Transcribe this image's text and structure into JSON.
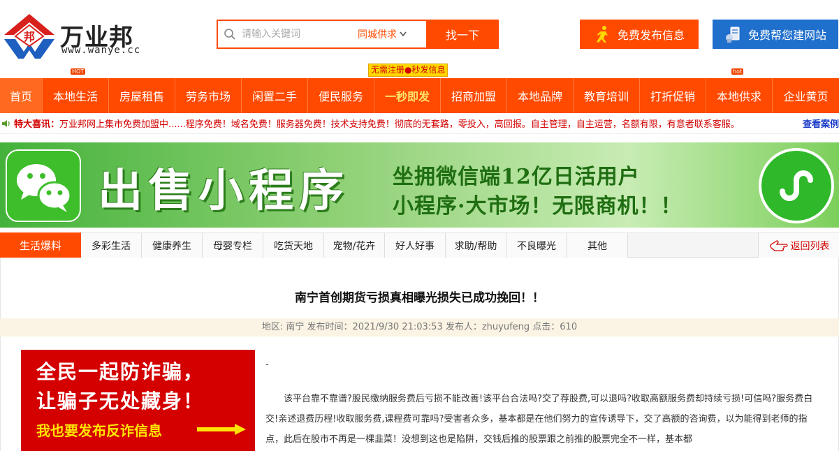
{
  "header": {
    "logo_text": "万业邦",
    "logo_url": "www.wanye.cc",
    "logo_glyph": "邦",
    "search_placeholder": "请输入关键词",
    "search_select": "同城供求",
    "search_button": "找一下",
    "publish_button": "免费发布信息",
    "site_button": "免费帮您建网站"
  },
  "nav": {
    "items": [
      {
        "label": "首页"
      },
      {
        "label": "本地生活"
      },
      {
        "label": "房屋租售"
      },
      {
        "label": "劳务市场"
      },
      {
        "label": "闲置二手"
      },
      {
        "label": "便民服务"
      },
      {
        "label": "一秒即发"
      },
      {
        "label": "招商加盟"
      },
      {
        "label": "本地品牌"
      },
      {
        "label": "教育培训"
      },
      {
        "label": "打折促销"
      },
      {
        "label": "本地供求"
      },
      {
        "label": "企业黄页"
      }
    ],
    "free_tag": "无需注册●秒发信息",
    "hot_badge": "HOT",
    "hot_badge2": "hot"
  },
  "notice": {
    "title": "特大喜讯：",
    "text": "万业邦网上集市免费加盟中......程序免费！域名免费！服务器免费！技术支持免费！彻底的无套路，零投入，高回报。自主管理，自主运营，名额有限，有意者联系客服。",
    "link": "查看案例"
  },
  "banner": {
    "title": "出售小程序",
    "line1": "坐拥微信端12亿日活用户",
    "line2": "小程序·大市场！无限商机！！"
  },
  "tabs": {
    "main": "生活爆料",
    "items": [
      "多彩生活",
      "健康养生",
      "母婴专栏",
      "吃货天地",
      "宠物/花卉",
      "好人好事",
      "求助/帮助",
      "不良曝光",
      "其他"
    ],
    "back": "返回列表"
  },
  "article": {
    "title": "南宁首创期货亏损真相曝光损失已成功挽回！！",
    "meta": "地区: 南宁 发布时间：2021/9/30 21:03:53 发布人：zhuyufeng 点击：610",
    "dash": "-",
    "paragraph": "该平台靠不靠谱?股民缴纳服务费后亏损不能改善!该平台合法吗?交了荐股费,可以退吗?收取高额服务费却持续亏损!可信吗?服务费白交!亲述退费历程!收取服务费,课程费可靠吗?受害者众多，基本都是在他们努力的宣传诱导下，交了高额的咨询费，以为能得到老师的指点，此后在股市不再是一棵韭菜！没想到这也是陷阱，交钱后推的股票跟之前推的股票完全不一样，基本都"
  },
  "ad": {
    "line1": "全民一起防诈骗，",
    "line2": "让骗子无处藏身！",
    "line3": "我也要发布反诈信息"
  },
  "colors": {
    "brand_orange": "#ff4a00",
    "brand_blue": "#1f6fcc",
    "notice_red": "#d20000"
  }
}
